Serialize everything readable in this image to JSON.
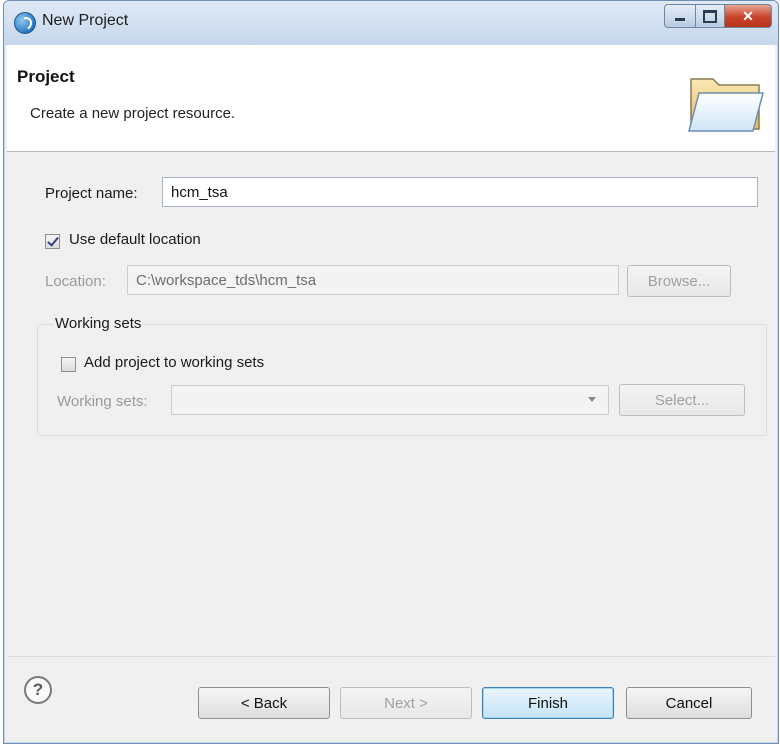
{
  "window": {
    "title": "New Project"
  },
  "banner": {
    "title": "Project",
    "description": "Create a new project resource."
  },
  "project_name": {
    "label": "Project name:",
    "value": "hcm_tsa"
  },
  "use_default_location": {
    "label": "Use default location",
    "checked": true
  },
  "location": {
    "label": "Location:",
    "value": "C:\\workspace_tds\\hcm_tsa",
    "browse_label": "Browse..."
  },
  "working_sets": {
    "group_title": "Working sets",
    "add_label": "Add project to working sets",
    "add_checked": false,
    "field_label": "Working sets:",
    "value": "",
    "select_label": "Select..."
  },
  "footer": {
    "help_symbol": "?",
    "back_label": "< Back",
    "next_label": "Next >",
    "finish_label": "Finish",
    "cancel_label": "Cancel"
  }
}
